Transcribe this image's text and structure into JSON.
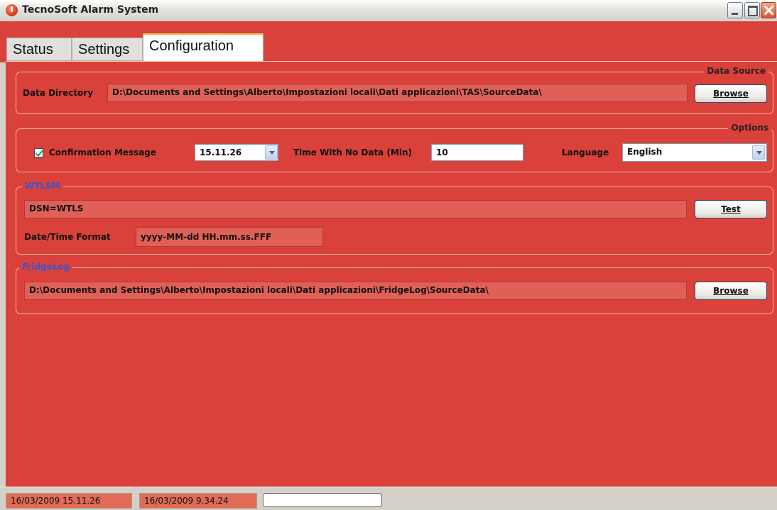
{
  "window": {
    "title": "TecnoSoft Alarm System"
  },
  "tabs": {
    "status": "Status",
    "settings": "Settings",
    "configuration": "Configuration"
  },
  "data_source": {
    "title": "Data Source",
    "directory_label": "Data Directory",
    "directory_value": "D:\\Documents and Settings\\Alberto\\Impostazioni locali\\Dati applicazioni\\TAS\\SourceData\\",
    "browse_label": "Browse"
  },
  "options": {
    "title": "Options",
    "confirmation_label": "Confirmation Message",
    "confirmation_checked": true,
    "confirmation_time": "15.11.26",
    "nodata_label": "Time With No Data (Min)",
    "nodata_value": "10",
    "language_label": "Language",
    "language_value": "English"
  },
  "wtlsm": {
    "title": "WTLSM",
    "dsn_value": "DSN=WTLS",
    "test_label": "Test",
    "datetime_label": "Date/Time Format",
    "datetime_value": "yyyy-MM-dd HH.mm.ss.FFF"
  },
  "fridgelog": {
    "title": "FridgeLog",
    "path_value": "D:\\Documents and Settings\\Alberto\\Impostazioni locali\\Dati applicazioni\\FridgeLog\\SourceData\\",
    "browse_label": "Browse"
  },
  "statusbar": {
    "time1": "16/03/2009 15.11.26",
    "time2": "16/03/2009 9.34.24"
  },
  "colors": {
    "panel": "#d9413a",
    "field": "#e06058",
    "group_title_blue": "#3a55d6",
    "group_title_dark": "#2b1f24"
  }
}
